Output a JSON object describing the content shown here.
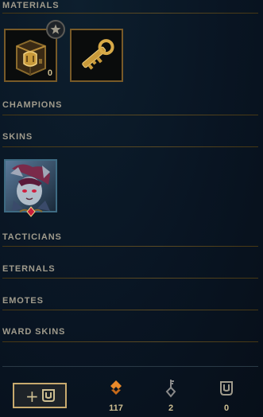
{
  "sections": {
    "materials": "MATERIALS",
    "champions": "CHAMPIONS",
    "skins": "SKINS",
    "tacticians": "TACTICIANS",
    "eternals": "ETERNALS",
    "emotes": "EMOTES",
    "ward_skins": "WARD SKINS"
  },
  "materials": {
    "items": [
      {
        "icon": "hextech-chest-icon",
        "count": "0"
      },
      {
        "icon": "hextech-key-icon"
      }
    ]
  },
  "skins": {
    "items": [
      {
        "icon": "skin-portrait-icon"
      }
    ]
  },
  "footer": {
    "add_label": "+",
    "currencies": [
      {
        "icon": "orange-essence-icon",
        "value": "117"
      },
      {
        "icon": "key-fragment-icon",
        "value": "2"
      },
      {
        "icon": "chest-currency-icon",
        "value": "0"
      }
    ]
  },
  "colors": {
    "gold": "#c8aa6e",
    "text": "#a09b8c",
    "background": "#091523",
    "orange_essence": "#e8892a"
  }
}
